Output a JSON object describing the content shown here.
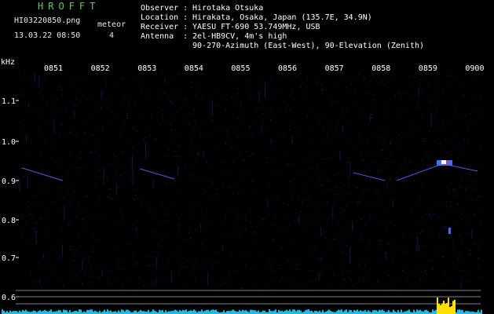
{
  "app": {
    "name": "HROFFT"
  },
  "capture": {
    "filename": "HI03220850.png",
    "datetime": "13.03.22 08:50",
    "meteor_label": "meteor",
    "meteor_count": "4"
  },
  "station": {
    "rows": [
      {
        "label": "Observer :",
        "value": "Hirotaka Otsuka"
      },
      {
        "label": "Location :",
        "value": "Hirakata, Osaka, Japan (135.7E, 34.9N)"
      },
      {
        "label": "Receiver :",
        "value": "YAESU FT-690 53.749MHz, USB"
      },
      {
        "label": "Antenna  :",
        "value": "2el-HB9CV, 4m's high"
      },
      {
        "label": "",
        "value": "90-270-Azimuth (East-West), 90-Elevation (Zenith)"
      }
    ]
  },
  "spectrogram": {
    "y_unit": "kHz",
    "time_labels": [
      "0851",
      "0852",
      "0853",
      "0854",
      "0855",
      "0856",
      "0857",
      "0858",
      "0859",
      "0900"
    ],
    "freq_labels": [
      "1.1",
      "1.0",
      "0.9",
      "0.8",
      "0.7",
      "0.6"
    ],
    "colors": {
      "background": "#000000",
      "noise": "#1a2a8a",
      "trace": "#3f6dff",
      "axis": "#ffffff",
      "level": "#2fd6ff",
      "peak": "#ffe000"
    }
  }
}
